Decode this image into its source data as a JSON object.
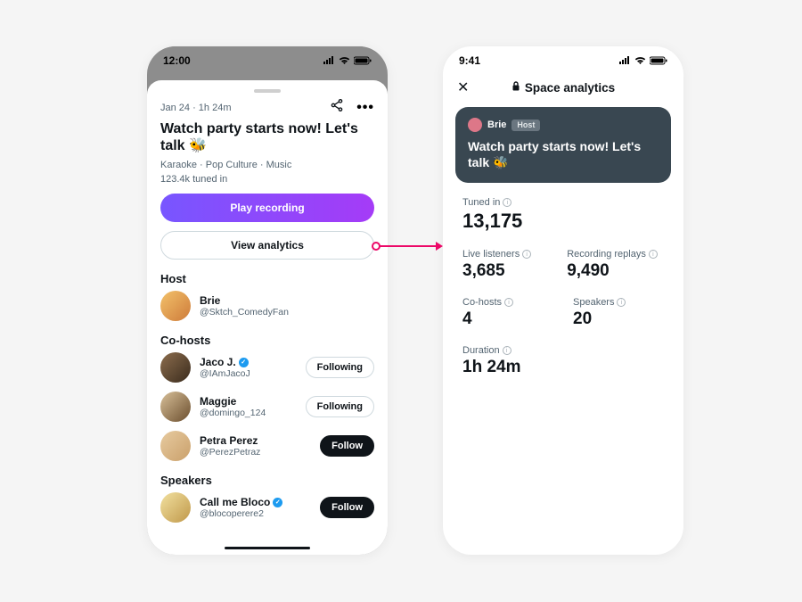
{
  "left": {
    "status_time": "12:00",
    "meta": "Jan 24 · 1h 24m",
    "title": "Watch party starts now! Let's talk 🐝",
    "tags": "Karaoke · Pop Culture · Music",
    "tuned_in": "123.4k tuned in",
    "play_label": "Play recording",
    "analytics_label": "View analytics",
    "sections": {
      "host": "Host",
      "cohosts": "Co-hosts",
      "speakers": "Speakers"
    },
    "host": {
      "name": "Brie",
      "handle": "@Sktch_ComedyFan"
    },
    "cohosts": [
      {
        "name": "Jaco J.",
        "handle": "@IAmJacoJ",
        "verified": true,
        "follow": "Following",
        "filled": false
      },
      {
        "name": "Maggie",
        "handle": "@domingo_124",
        "verified": false,
        "follow": "Following",
        "filled": false
      },
      {
        "name": "Petra Perez",
        "handle": "@PerezPetraz",
        "verified": false,
        "follow": "Follow",
        "filled": true
      }
    ],
    "speakers": [
      {
        "name": "Call me Bloco",
        "handle": "@blocoperere2",
        "verified": true,
        "follow": "Follow",
        "filled": true
      }
    ]
  },
  "right": {
    "status_time": "9:41",
    "header": "Space analytics",
    "card": {
      "name": "Brie",
      "host_label": "Host",
      "title": "Watch party starts now! Let's talk 🐝"
    },
    "stats": {
      "tuned_in_label": "Tuned in",
      "tuned_in_value": "13,175",
      "live_label": "Live listeners",
      "live_value": "3,685",
      "replays_label": "Recording replays",
      "replays_value": "9,490",
      "cohosts_label": "Co-hosts",
      "cohosts_value": "4",
      "speakers_label": "Speakers",
      "speakers_value": "20",
      "duration_label": "Duration",
      "duration_value": "1h 24m"
    }
  }
}
